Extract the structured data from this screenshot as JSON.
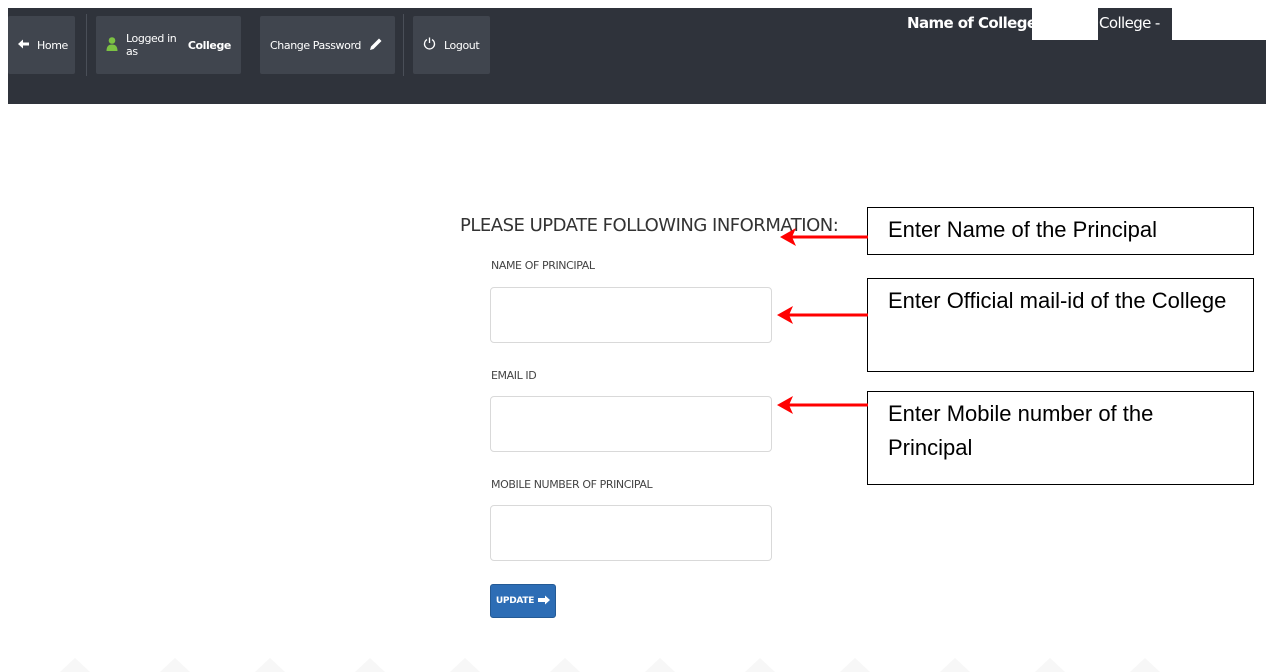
{
  "nav": {
    "home_label": "Home",
    "logged_prefix": "Logged in as",
    "logged_role": "College",
    "change_password_label": "Change Password",
    "logout_label": "Logout"
  },
  "header": {
    "name_of_college_label": "Name of College:",
    "college_suffix": "College -"
  },
  "form": {
    "title": "PLEASE UPDATE FOLLOWING INFORMATION:",
    "principal_label": "NAME OF PRINCIPAL",
    "email_label": "EMAIL ID",
    "mobile_label": "MOBILE NUMBER OF PRINCIPAL",
    "principal_value": "",
    "email_value": "",
    "mobile_value": "",
    "update_label": "UPDATE"
  },
  "callouts": {
    "principal": "Enter Name of the Principal",
    "email": "Enter Official mail-id of the College",
    "mobile": "Enter Mobile number of the Principal"
  },
  "colors": {
    "navbar": "#2f333b",
    "nav_button": "#40454e",
    "update_button": "#2d6db5",
    "arrow": "#ff0000",
    "user_icon": "#7cc243"
  }
}
